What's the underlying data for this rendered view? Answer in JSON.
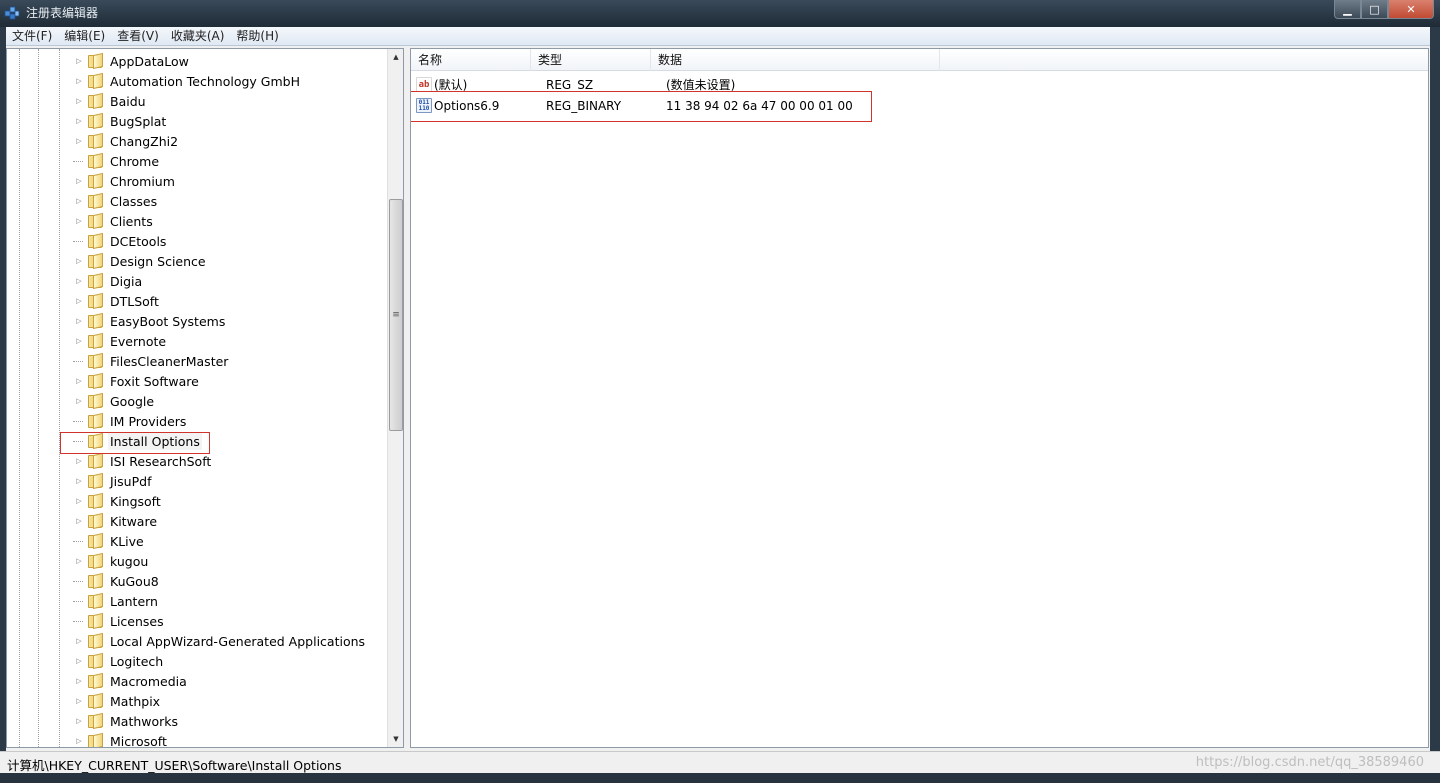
{
  "window": {
    "title": "注册表编辑器"
  },
  "menu": [
    "文件(F)",
    "编辑(E)",
    "查看(V)",
    "收藏夹(A)",
    "帮助(H)"
  ],
  "tree": {
    "items": [
      {
        "label": "AppDataLow",
        "expandable": true
      },
      {
        "label": "Automation Technology GmbH",
        "expandable": true
      },
      {
        "label": "Baidu",
        "expandable": true
      },
      {
        "label": "BugSplat",
        "expandable": true
      },
      {
        "label": "ChangZhi2",
        "expandable": true
      },
      {
        "label": "Chrome",
        "expandable": false
      },
      {
        "label": "Chromium",
        "expandable": true
      },
      {
        "label": "Classes",
        "expandable": true
      },
      {
        "label": "Clients",
        "expandable": true
      },
      {
        "label": "DCEtools",
        "expandable": false
      },
      {
        "label": "Design Science",
        "expandable": true
      },
      {
        "label": "Digia",
        "expandable": true
      },
      {
        "label": "DTLSoft",
        "expandable": true
      },
      {
        "label": "EasyBoot Systems",
        "expandable": true
      },
      {
        "label": "Evernote",
        "expandable": true
      },
      {
        "label": "FilesCleanerMaster",
        "expandable": false
      },
      {
        "label": "Foxit Software",
        "expandable": true
      },
      {
        "label": "Google",
        "expandable": true
      },
      {
        "label": "IM Providers",
        "expandable": false
      },
      {
        "label": "Install Options",
        "expandable": false,
        "selected": true
      },
      {
        "label": "ISI ResearchSoft",
        "expandable": true
      },
      {
        "label": "JisuPdf",
        "expandable": true
      },
      {
        "label": "Kingsoft",
        "expandable": true
      },
      {
        "label": "Kitware",
        "expandable": true
      },
      {
        "label": "KLive",
        "expandable": false
      },
      {
        "label": "kugou",
        "expandable": true
      },
      {
        "label": "KuGou8",
        "expandable": false
      },
      {
        "label": "Lantern",
        "expandable": false
      },
      {
        "label": "Licenses",
        "expandable": false
      },
      {
        "label": "Local AppWizard-Generated Applications",
        "expandable": true
      },
      {
        "label": "Logitech",
        "expandable": true
      },
      {
        "label": "Macromedia",
        "expandable": true
      },
      {
        "label": "Mathpix",
        "expandable": true
      },
      {
        "label": "Mathworks",
        "expandable": true
      },
      {
        "label": "Microsoft",
        "expandable": true
      }
    ]
  },
  "list": {
    "columns": [
      "名称",
      "类型",
      "数据"
    ],
    "rows": [
      {
        "icon": "string-value-icon",
        "name": "(默认)",
        "type": "REG_SZ",
        "data": "(数值未设置)"
      },
      {
        "icon": "binary-value-icon",
        "name": "Options6.9",
        "type": "REG_BINARY",
        "data": "11 38 94 02 6a 47 00 00 01 00"
      }
    ]
  },
  "status": {
    "path": "计算机\\HKEY_CURRENT_USER\\Software\\Install Options"
  },
  "watermark": "https://blog.csdn.net/qq_38589460",
  "colors": {
    "highlight_box": "#d0342c",
    "title_bar": "#1f2b36",
    "menu_bar": "#dfe8f3"
  }
}
